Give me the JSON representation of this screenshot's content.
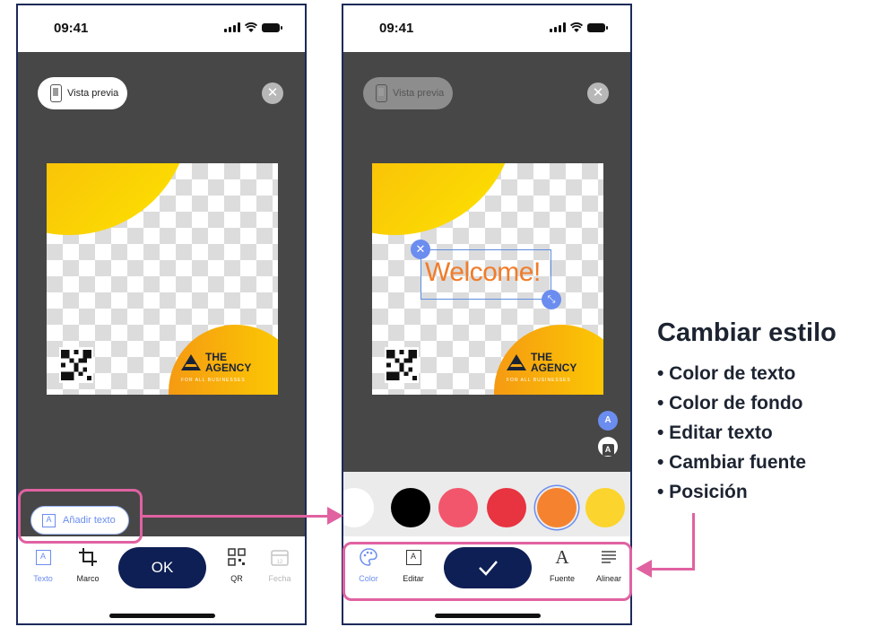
{
  "status": {
    "time": "09:41"
  },
  "screen1": {
    "preview_label": "Vista previa",
    "add_text_label": "Añadir texto",
    "ok_label": "OK",
    "tools": [
      {
        "label": "Texto",
        "icon": "text-icon"
      },
      {
        "label": "Marco",
        "icon": "crop-icon"
      },
      {
        "label": "QR",
        "icon": "qr-icon"
      },
      {
        "label": "Fecha",
        "icon": "calendar-icon"
      }
    ]
  },
  "screen2": {
    "preview_label": "Vista previa",
    "text_element": "Welcome!",
    "side_buttons": [
      "A",
      "A"
    ],
    "swatches": [
      "#ffffff",
      "#000000",
      "#f2566c",
      "#e83340",
      "#f5822e",
      "#fbd42e"
    ],
    "selected_swatch": 4,
    "tools": [
      {
        "label": "Color",
        "icon": "palette-icon"
      },
      {
        "label": "Editar",
        "icon": "edit-text-icon"
      },
      {
        "label": "Fuente",
        "icon": "font-icon"
      },
      {
        "label": "Alinear",
        "icon": "align-icon"
      }
    ]
  },
  "template": {
    "brand_line1": "THE",
    "brand_line2": "AGENCY",
    "brand_tagline": "FOR ALL BUSINESSES"
  },
  "annotation": {
    "title": "Cambiar estilo",
    "items": [
      "• Color de texto",
      "• Color de fondo",
      "• Editar texto",
      "• Cambiar fuente",
      "• Posición"
    ]
  },
  "colors": {
    "accent": "#6b8df0",
    "navy": "#0e1f55",
    "highlight": "#e062a1",
    "editor_bg": "#474747"
  }
}
